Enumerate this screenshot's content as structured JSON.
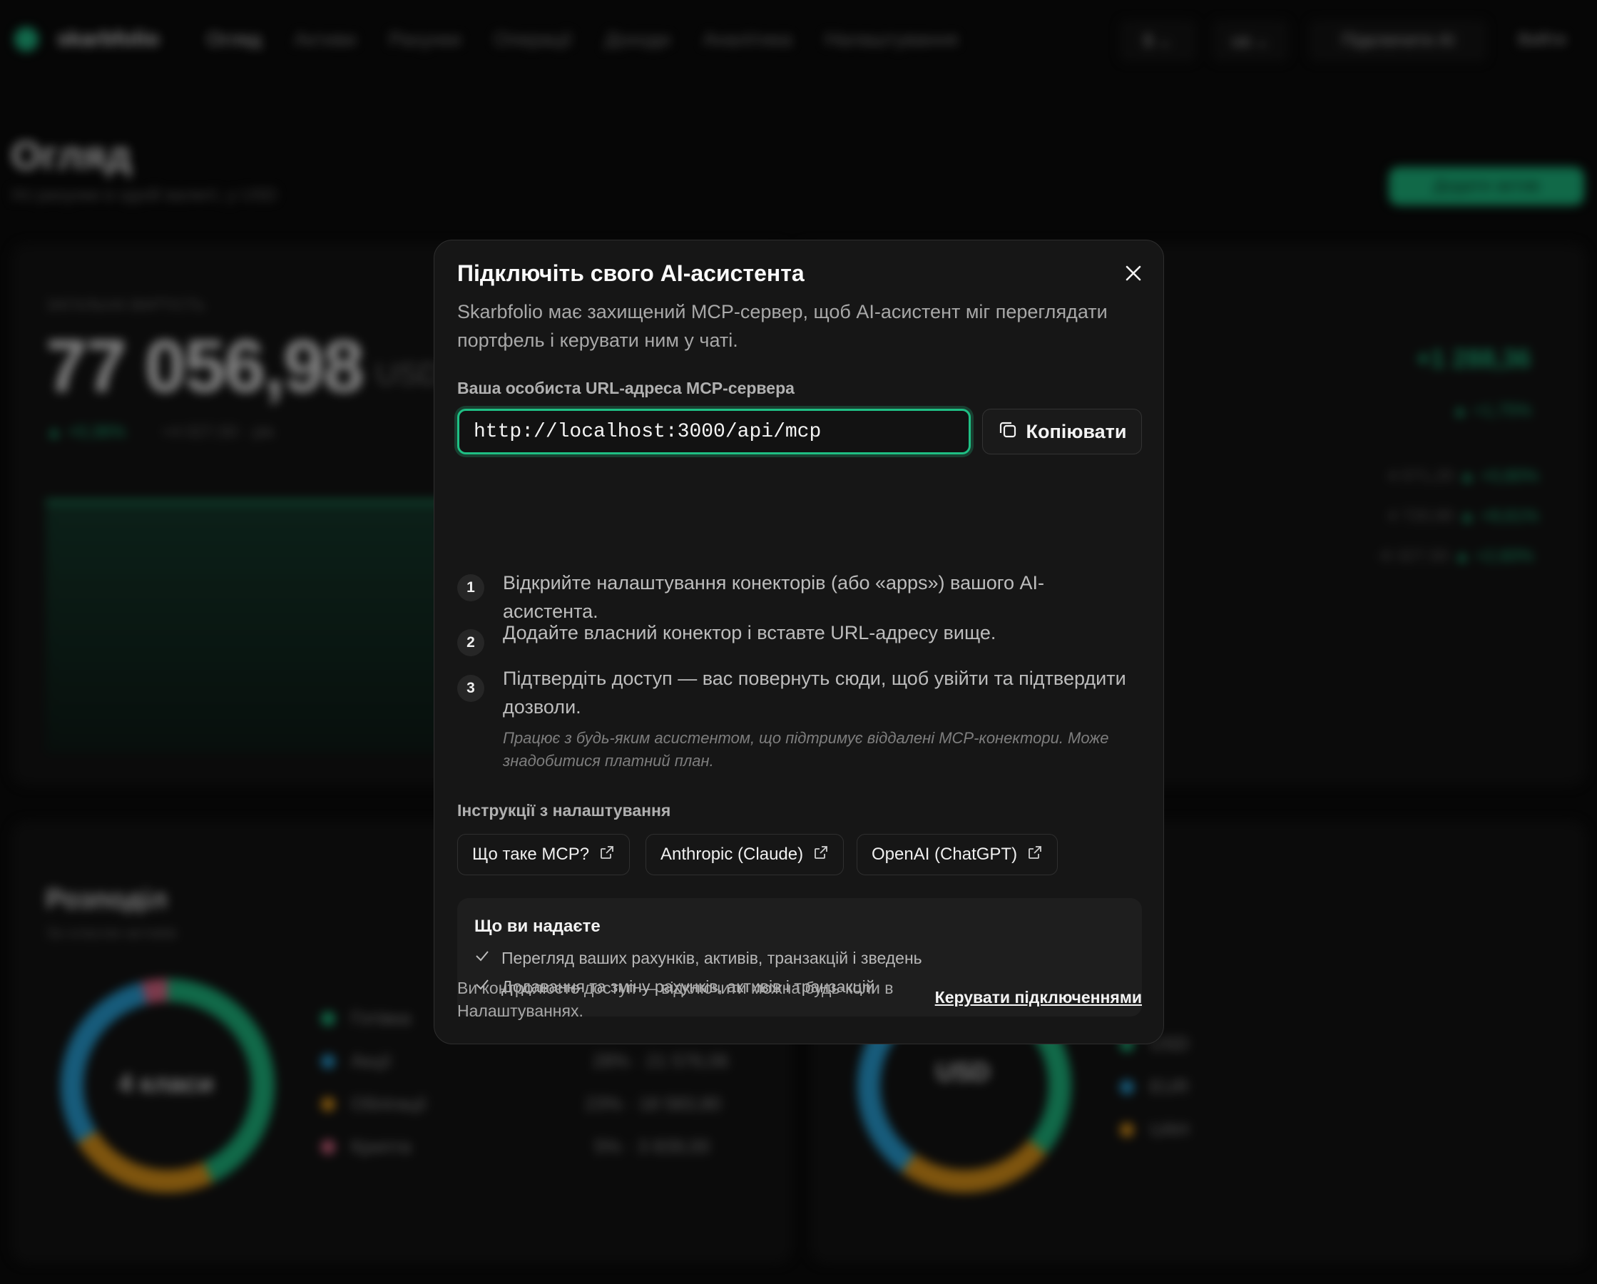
{
  "modal": {
    "title": "Підключіть свого AI-асистента",
    "description": "Skarbfolio має захищений MCP-сервер, щоб AI-асистент міг переглядати портфель і керувати ним у чаті.",
    "url_label": "Ваша особиста URL-адреса MCP-сервера",
    "url_value": "http://localhost:3000/api/mcp",
    "copy_label": "Копіювати",
    "steps": [
      {
        "num": "1",
        "text": "Відкрийте налаштування конекторів (або «apps») вашого AI-асистента."
      },
      {
        "num": "2",
        "text": "Додайте власний конектор і вставте URL-адресу вище."
      },
      {
        "num": "3",
        "text": "Підтвердіть доступ — вас повернуть сюди, щоб увійти та підтвердити дозволи."
      }
    ],
    "note": "Працює з будь-яким асистентом, що підтримує віддалені MCP-конектори. Може знадобитися платний план.",
    "instructions_label": "Інструкції з налаштування",
    "links": [
      "Що таке MCP?",
      "Anthropic (Claude)",
      "OpenAI (ChatGPT)"
    ],
    "permissions": {
      "title": "Що ви надаєте",
      "items": [
        "Перегляд ваших рахунків, активів, транзакцій і зведень",
        "Додавання та зміну рахунків, активів і транзакцій"
      ]
    },
    "footer_text": "Ви контролюєте доступ — відключити можна будь-коли в Налаштуваннях.",
    "footer_link": "Керувати підключеннями"
  },
  "background": {
    "page_title": "Огляд",
    "total_value": "77 056,98"
  },
  "colors": {
    "accent": "#1fbf84",
    "modal_bg": "#161616",
    "page_bg": "#0b0b0b"
  }
}
